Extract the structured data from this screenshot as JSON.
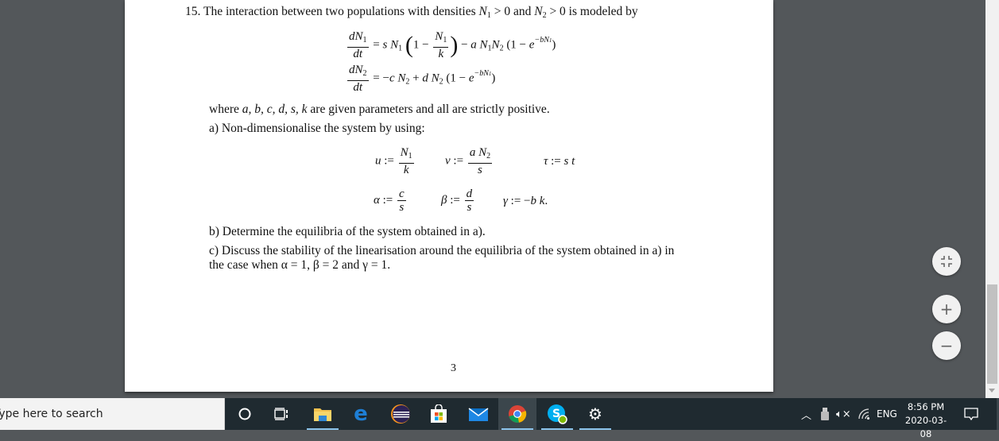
{
  "document": {
    "problem_intro": "15. The interaction between two populations with densities N₁ > 0 and N₂ > 0 is modeled by",
    "intro_parts": {
      "lead": "15. The interaction between two populations with densities ",
      "cond1": "N",
      "cond1_sub": "1",
      "gt0a": " > 0 and ",
      "cond2": "N",
      "cond2_sub": "2",
      "gt0b": " > 0 is modeled by"
    },
    "equations": [
      "dN₁/dt = s N₁ (1 − N₁/k) − a N₁N₂ (1 − e^(−bN₁))",
      "dN₂/dt = −c N₂ + d N₂ (1 − e^(−bN₁))"
    ],
    "where_text": "where a, b, c, d, s, k are given parameters and all are strictly positive.",
    "where_parts": {
      "lead": "where ",
      "params": "a, b, c, d, s, k",
      "tail": " are given parameters and all are strictly positive."
    },
    "part_a": "a) Non-dimensionalise the system by using:",
    "definitions": [
      "u := N₁/k",
      "v := a N₂/s",
      "τ := s t",
      "α := c/s",
      "β := d/s",
      "γ := −b k."
    ],
    "part_b": "b) Determine the equilibria of the system obtained in a).",
    "part_c_line1": "c) Discuss the stability of the linearisation around the equilibria of the system obtained in a) in",
    "part_c_line2": "the case when α = 1, β = 2 and γ = 1.",
    "page_number": "3"
  },
  "viewer_controls": {
    "fit_icon": "fit-to-page-icon",
    "zoom_in_label": "+",
    "zoom_out_label": "−"
  },
  "taskbar": {
    "search_placeholder": "Type here to search",
    "apps": [
      {
        "name": "cortana",
        "icon": "cortana-circle-icon"
      },
      {
        "name": "task-view",
        "icon": "task-view-icon"
      },
      {
        "name": "file-explorer",
        "icon": "folder-icon"
      },
      {
        "name": "edge",
        "icon": "edge-icon"
      },
      {
        "name": "eclipse",
        "icon": "eclipse-icon"
      },
      {
        "name": "store",
        "icon": "store-bag-icon"
      },
      {
        "name": "mail",
        "icon": "mail-icon"
      },
      {
        "name": "chrome",
        "icon": "chrome-icon"
      },
      {
        "name": "skype",
        "icon": "skype-icon"
      },
      {
        "name": "settings",
        "icon": "gear-icon"
      }
    ],
    "tray": {
      "language": "ENG",
      "time": "8:56 PM",
      "date": "2020-03-08"
    }
  }
}
